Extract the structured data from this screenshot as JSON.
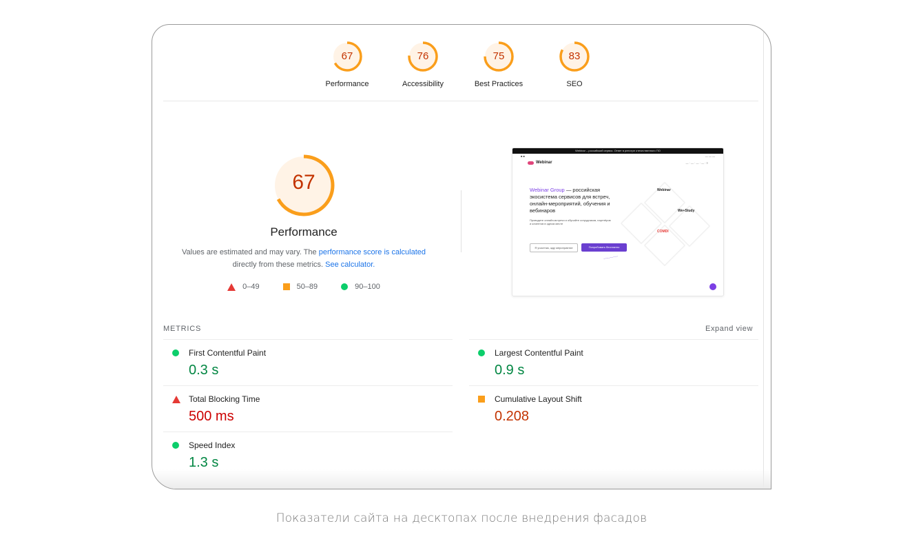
{
  "categories": [
    {
      "score": "67",
      "label": "Performance",
      "fraction": 0.67
    },
    {
      "score": "76",
      "label": "Accessibility",
      "fraction": 0.76
    },
    {
      "score": "75",
      "label": "Best Practices",
      "fraction": 0.75
    },
    {
      "score": "83",
      "label": "SEO",
      "fraction": 0.83
    }
  ],
  "performance": {
    "score": "67",
    "fraction": 0.67,
    "title": "Performance",
    "desc_prefix": "Values are estimated and may vary. The ",
    "desc_link": "performance score is calculated",
    "desc_middle": " directly from these metrics. ",
    "desc_link2": "See calculator.",
    "legend": {
      "fail": "0–49",
      "average": "50–89",
      "pass": "90–100"
    }
  },
  "thumbnail": {
    "banner": "Webinar – российский сервис. Ответ в реестре отечественного ПО",
    "logo": "Webinar",
    "headline_brand": "Webinar Group",
    "headline_rest": " — российская экосистема сервисов для встреч, онлайн-мероприятий, обучения и вебинаров",
    "subtext": "Проводите онлайн-встречи и обучайте сотрудников, партнёров и клиентов в одном месте",
    "btn_secondary": "Я участник, жду мероприятие",
    "btn_primary": "Попробовать бесплатно",
    "products": [
      "Webinar",
      "We+Study",
      "COMDI"
    ]
  },
  "metrics": {
    "heading": "METRICS",
    "expand": "Expand view",
    "items": [
      {
        "name": "First Contentful Paint",
        "value": "0.3 s",
        "status": "pass"
      },
      {
        "name": "Largest Contentful Paint",
        "value": "0.9 s",
        "status": "pass"
      },
      {
        "name": "Total Blocking Time",
        "value": "500 ms",
        "status": "fail"
      },
      {
        "name": "Cumulative Layout Shift",
        "value": "0.208",
        "status": "average"
      },
      {
        "name": "Speed Index",
        "value": "1.3 s",
        "status": "pass"
      }
    ]
  },
  "colors": {
    "average": "#fa9e1b",
    "fail": "#e53935",
    "pass": "#0cce6b",
    "gauge_bg": "#fff3e6"
  },
  "caption": "Показатели сайта на десктопах после внедрения фасадов"
}
